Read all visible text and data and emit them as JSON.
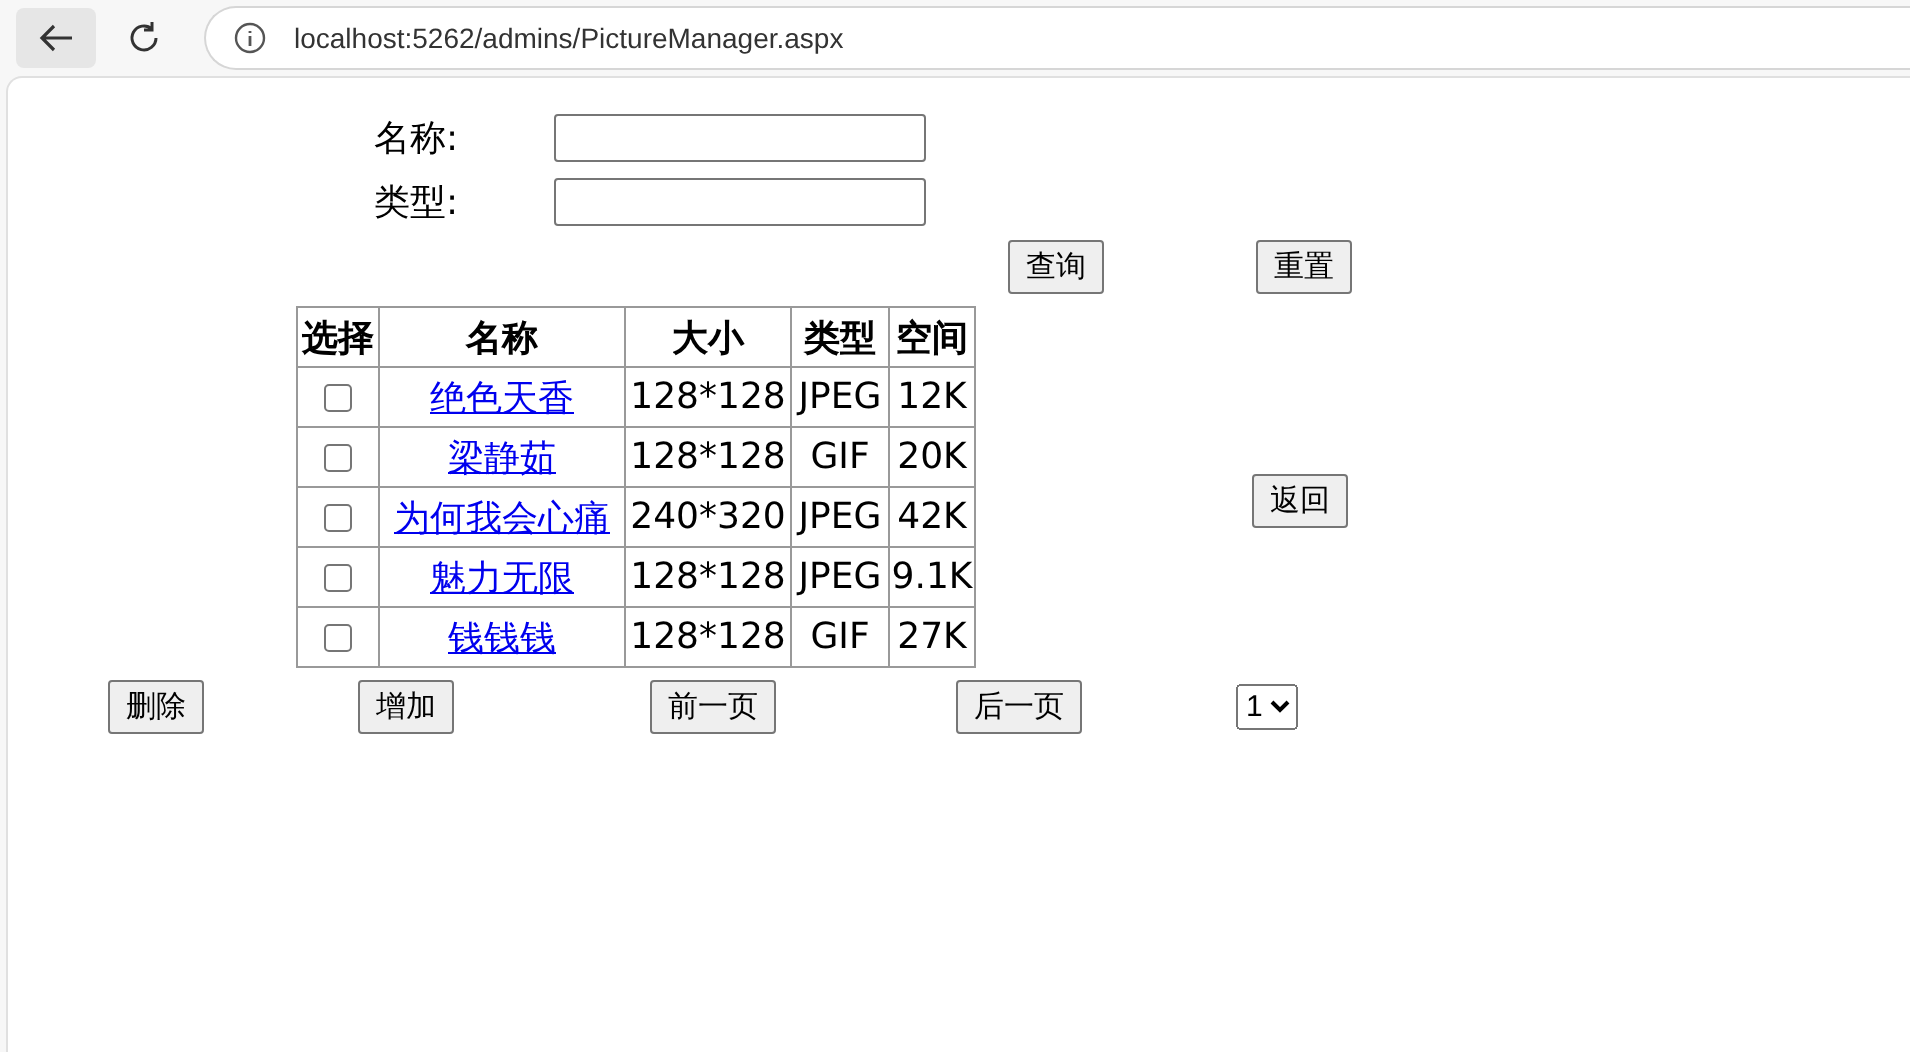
{
  "browser": {
    "url": "localhost:5262/admins/PictureManager.aspx"
  },
  "search_form": {
    "fields": [
      {
        "label": "名称:"
      },
      {
        "label": "类型:"
      }
    ],
    "buttons": [
      "查询",
      "重置"
    ]
  },
  "table": {
    "columns": [
      "选择",
      "名称",
      "大小",
      "类型",
      "空间"
    ],
    "rows": [
      {
        "checked": false,
        "name": "绝色天香",
        "size": "128*128",
        "type": "JPEG",
        "space": "12K"
      },
      {
        "checked": false,
        "name": "梁静茹",
        "size": "128*128",
        "type": "GIF",
        "space": "20K"
      },
      {
        "checked": false,
        "name": "为何我会心痛",
        "size": "240*320",
        "type": "JPEG",
        "space": "42K"
      },
      {
        "checked": false,
        "name": "魅力无限",
        "size": "128*128",
        "type": "JPEG",
        "space": "9.1K"
      },
      {
        "checked": false,
        "name": "钱钱钱",
        "size": "128*128",
        "type": "GIF",
        "space": "27K"
      }
    ]
  },
  "back_button": "返回",
  "footer_buttons": [
    "删除",
    "增加",
    "前一页",
    "后一页"
  ],
  "page_select": {
    "value": "1"
  }
}
